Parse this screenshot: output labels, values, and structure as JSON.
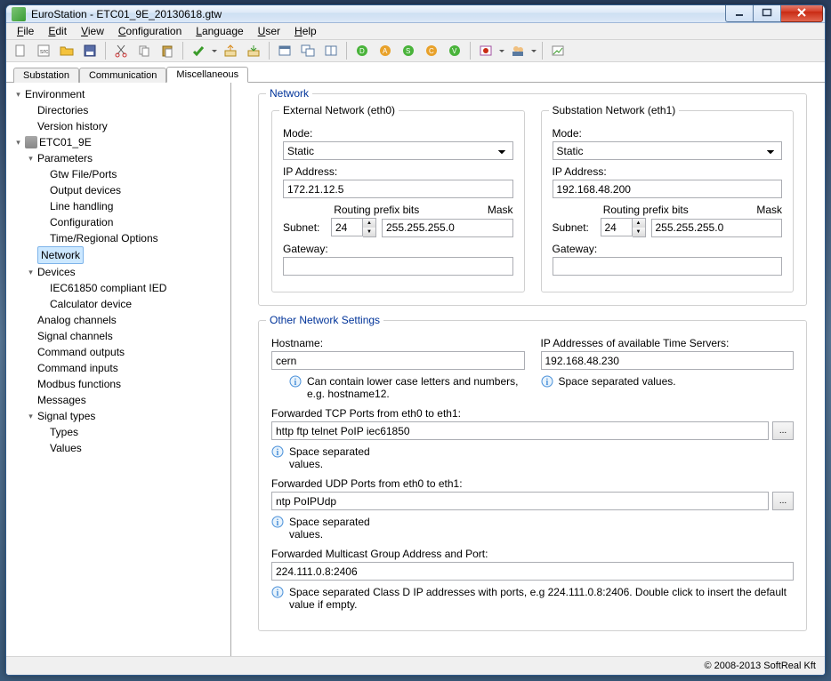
{
  "window": {
    "title": "EuroStation - ETC01_9E_20130618.gtw"
  },
  "menu": [
    "File",
    "Edit",
    "View",
    "Configuration",
    "Language",
    "User",
    "Help"
  ],
  "tabs": [
    {
      "label": "Substation"
    },
    {
      "label": "Communication"
    },
    {
      "label": "Miscellaneous",
      "active": true
    }
  ],
  "tree": {
    "root": "Environment",
    "env": [
      "Directories",
      "Version history"
    ],
    "station": "ETC01_9E",
    "params": "Parameters",
    "params_children": [
      "Gtw File/Ports",
      "Output devices",
      "Line handling",
      "Configuration",
      "Time/Regional Options"
    ],
    "selected": "Network",
    "devices": "Devices",
    "devices_children": [
      "IEC61850 compliant IED",
      "Calculator device"
    ],
    "rest": [
      "Analog channels",
      "Signal channels",
      "Command outputs",
      "Command inputs",
      "Modbus functions",
      "Messages"
    ],
    "sig": "Signal types",
    "sig_children": [
      "Types",
      "Values"
    ]
  },
  "panel": {
    "group_network": "Network",
    "eth0": {
      "legend": "External  Network (eth0)",
      "mode_label": "Mode:",
      "mode": "Static",
      "ip_label": "IP Address:",
      "ip": "172.21.12.5",
      "routing_label": "Routing prefix bits",
      "mask_label": "Mask",
      "subnet_label": "Subnet:",
      "prefix": "24",
      "mask": "255.255.255.0",
      "gw_label": "Gateway:",
      "gw": ""
    },
    "eth1": {
      "legend": "Substation Network (eth1)",
      "mode_label": "Mode:",
      "mode": "Static",
      "ip_label": "IP Address:",
      "ip": "192.168.48.200",
      "routing_label": "Routing prefix bits",
      "mask_label": "Mask",
      "subnet_label": "Subnet:",
      "prefix": "24",
      "mask": "255.255.255.0",
      "gw_label": "Gateway:",
      "gw": ""
    },
    "group_other": "Other Network Settings",
    "hostname_label": "Hostname:",
    "hostname": "cern",
    "hostname_hint": "Can contain  lower case letters and numbers, e.g. hostname12.",
    "ts_label": "IP Addresses of available Time Servers:",
    "ts": "192.168.48.230",
    "ts_hint": "Space separated values.",
    "tcp_label": "Forwarded TCP Ports from eth0 to eth1:",
    "tcp": "http ftp telnet PoIP iec61850",
    "tcp_hint": "Space separated values.",
    "udp_label": "Forwarded UDP Ports from eth0 to eth1:",
    "udp": "ntp PoIPUdp",
    "udp_hint": "Space separated values.",
    "mc_label": "Forwarded Multicast Group Address and Port:",
    "mc": "224.111.0.8:2406",
    "mc_hint": "Space separated Class D IP addresses with ports, e.g 224.111.0.8:2406. Double click to insert the default value if empty."
  },
  "status": "© 2008-2013 SoftReal Kft"
}
